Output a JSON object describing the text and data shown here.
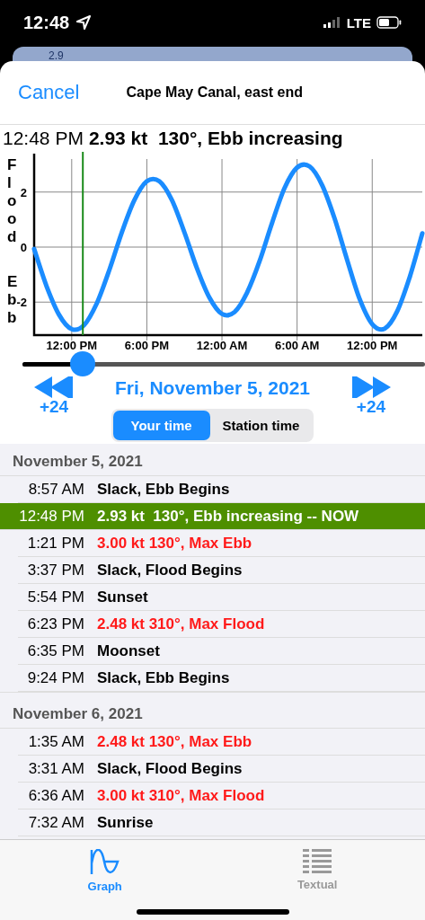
{
  "status_bar": {
    "time": "12:48",
    "network": "LTE"
  },
  "background_card": {
    "text": "2.9"
  },
  "nav": {
    "cancel": "Cancel",
    "title": "Cape May Canal, east end"
  },
  "readout": {
    "time": "12:48 PM",
    "value": "2.93 kt  130°, Ebb increasing"
  },
  "axis_labels": {
    "flood": "Flood",
    "ebb": "Ebb"
  },
  "chart_data": {
    "type": "line",
    "categories": [
      null,
      null,
      null,
      "12:00 PM",
      null,
      null,
      null,
      null,
      null,
      "6:00 PM",
      null,
      null,
      null,
      null,
      null,
      "12:00 AM",
      null,
      null,
      null,
      null,
      null,
      "6:00 AM",
      null,
      null,
      null,
      null,
      null,
      "12:00 PM",
      null,
      null,
      null,
      null
    ],
    "series": [
      {
        "color": "#1a8cff",
        "values": [
          -0.07,
          -1.43,
          -2.47,
          -2.98,
          -2.83,
          -2.05,
          -0.84,
          0.53,
          1.7,
          2.39,
          2.39,
          1.71,
          0.54,
          -0.77,
          -1.84,
          -2.43,
          -2.36,
          -1.66,
          -0.52,
          0.88,
          2.15,
          2.89,
          2.93,
          2.25,
          1.03,
          -0.47,
          -1.89,
          -2.8,
          -2.96,
          -2.33,
          -1.08,
          0.5
        ]
      }
    ],
    "ylim": [
      -3.2,
      3.2
    ],
    "grid": true,
    "yticks": [
      -2,
      0,
      2
    ]
  },
  "time_slider": {
    "level": 0.15
  },
  "date_nav": {
    "back_label": "+24",
    "date": "Fri, November 5, 2021",
    "forward_label": "+24"
  },
  "segments": [
    {
      "label": "Your time",
      "selected": true
    },
    {
      "label": "Station time",
      "selected": false
    }
  ],
  "sections": [
    {
      "title": "November 5, 2021",
      "rows": [
        {
          "time": "8:57 AM",
          "text": "Slack, Ebb Begins",
          "kind": "event"
        },
        {
          "time": "12:48 PM",
          "text": "2.93 kt  130°, Ebb increasing -- NOW",
          "kind": "now"
        },
        {
          "time": "1:21 PM",
          "text": "3.00 kt 130°, Max Ebb",
          "kind": "max"
        },
        {
          "time": "3:37 PM",
          "text": "Slack, Flood Begins",
          "kind": "event"
        },
        {
          "time": "5:54 PM",
          "text": "Sunset",
          "kind": "event"
        },
        {
          "time": "6:23 PM",
          "text": "2.48 kt 310°, Max Flood",
          "kind": "max"
        },
        {
          "time": "6:35 PM",
          "text": "Moonset",
          "kind": "event"
        },
        {
          "time": "9:24 PM",
          "text": "Slack, Ebb Begins",
          "kind": "event"
        }
      ]
    },
    {
      "title": "November 6, 2021",
      "rows": [
        {
          "time": "1:35 AM",
          "text": "2.48 kt 130°, Max Ebb",
          "kind": "max"
        },
        {
          "time": "3:31 AM",
          "text": "Slack, Flood Begins",
          "kind": "event"
        },
        {
          "time": "6:36 AM",
          "text": "3.00 kt 310°, Max Flood",
          "kind": "max"
        },
        {
          "time": "7:32 AM",
          "text": "Sunrise",
          "kind": "event"
        }
      ]
    }
  ],
  "tab_bar": [
    {
      "label": "Graph",
      "kind": "graph",
      "selected": true
    },
    {
      "label": "Textual",
      "kind": "list",
      "selected": false
    }
  ]
}
